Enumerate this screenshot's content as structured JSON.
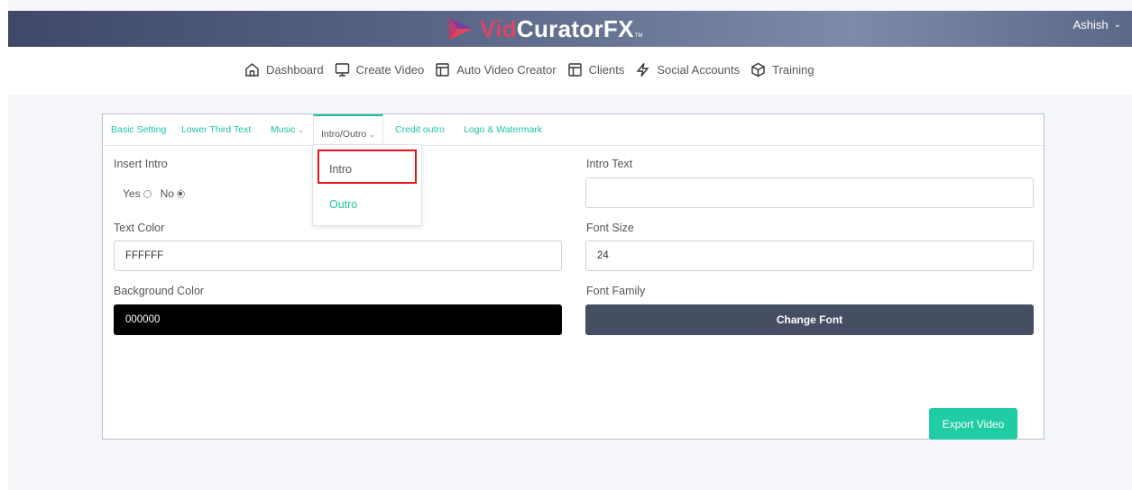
{
  "header": {
    "logo": {
      "part1": "Vid",
      "part2": "CuratorFX",
      "tm": "TM"
    },
    "user": {
      "name": "Ashish"
    },
    "colors": {
      "accent": "#1fc4a0",
      "brand_red": "#d9466a",
      "highlight": "#e0161c"
    }
  },
  "nav": {
    "items": [
      {
        "label": "Dashboard",
        "icon": "home-icon"
      },
      {
        "label": "Create Video",
        "icon": "monitor-icon"
      },
      {
        "label": "Auto Video Creator",
        "icon": "layout-icon"
      },
      {
        "label": "Clients",
        "icon": "layout-icon"
      },
      {
        "label": "Social Accounts",
        "icon": "lightning-icon"
      },
      {
        "label": "Training",
        "icon": "cube-icon"
      }
    ]
  },
  "tabs": {
    "basic": "Basic Setting",
    "lower_third": "Lower Third Text",
    "music": "Music",
    "intro_outro": "Intro/Outro",
    "credit": "Credit outro",
    "logo": "Logo & Watermark"
  },
  "dropdown": {
    "items": [
      "Intro",
      "Outro"
    ]
  },
  "form": {
    "insert_intro": {
      "label": "Insert Intro",
      "yes": "Yes",
      "no": "No",
      "selected": "No"
    },
    "intro_text": {
      "label": "Intro Text",
      "value": ""
    },
    "text_color": {
      "label": "Text Color",
      "value": "FFFFFF"
    },
    "font_size": {
      "label": "Font Size",
      "value": "24"
    },
    "bg_color": {
      "label": "Background Color",
      "value": "000000"
    },
    "font_family": {
      "label": "Font Family",
      "button": "Change Font"
    }
  },
  "actions": {
    "export": "Export Video"
  }
}
